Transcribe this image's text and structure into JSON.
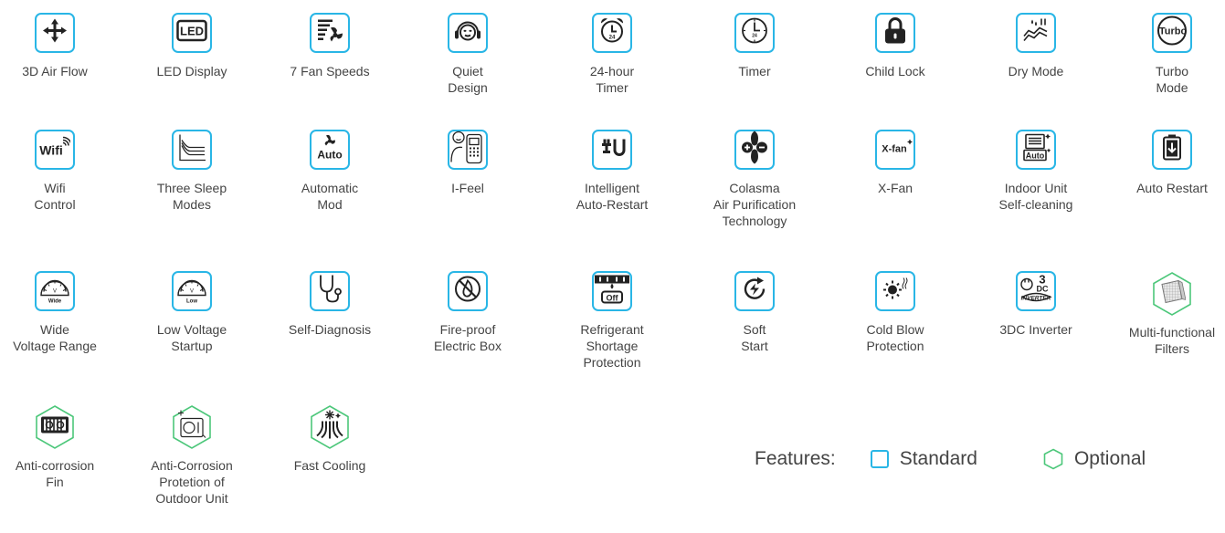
{
  "colors": {
    "standard": "#29b6e6",
    "optional": "#4cc77a",
    "icon": "#222222"
  },
  "features": [
    {
      "label": "3D Air Flow",
      "type": "standard",
      "icon": "arrows-icon"
    },
    {
      "label": "LED Display",
      "type": "standard",
      "icon": "led-icon"
    },
    {
      "label": "7 Fan Speeds",
      "type": "standard",
      "icon": "fan-speed-icon"
    },
    {
      "label": "Quiet\nDesign",
      "type": "standard",
      "icon": "headphones-icon"
    },
    {
      "label": "24-hour\nTimer",
      "type": "standard",
      "icon": "alarm-clock-icon"
    },
    {
      "label": "Timer",
      "type": "standard",
      "icon": "clock-icon"
    },
    {
      "label": "Child Lock",
      "type": "standard",
      "icon": "lock-icon"
    },
    {
      "label": "Dry Mode",
      "type": "standard",
      "icon": "dry-icon"
    },
    {
      "label": "Turbo\nMode",
      "type": "standard",
      "icon": "turbo-icon"
    },
    {
      "label": "Wifi\nControl",
      "type": "standard",
      "icon": "wifi-icon"
    },
    {
      "label": "Three Sleep\nModes",
      "type": "standard",
      "icon": "sleep-graph-icon"
    },
    {
      "label": "Automatic\nMod",
      "type": "standard",
      "icon": "auto-fan-icon"
    },
    {
      "label": "I-Feel",
      "type": "standard",
      "icon": "i-feel-icon"
    },
    {
      "label": "Intelligent\nAuto-Restart",
      "type": "standard",
      "icon": "plug-icon"
    },
    {
      "label": "Colasma\nAir Purification\nTechnology",
      "type": "standard",
      "icon": "plasma-icon"
    },
    {
      "label": "X-Fan",
      "type": "standard",
      "icon": "x-fan-icon"
    },
    {
      "label": "Indoor Unit\nSelf-cleaning",
      "type": "standard",
      "icon": "self-clean-icon"
    },
    {
      "label": "Auto Restart",
      "type": "standard",
      "icon": "battery-icon"
    },
    {
      "label": "Wide\nVoltage Range",
      "type": "standard",
      "icon": "gauge-wide-icon"
    },
    {
      "label": "Low Voltage\nStartup",
      "type": "standard",
      "icon": "gauge-low-icon"
    },
    {
      "label": "Self-Diagnosis",
      "type": "standard",
      "icon": "stethoscope-icon"
    },
    {
      "label": "Fire-proof\nElectric Box",
      "type": "standard",
      "icon": "fire-proof-icon"
    },
    {
      "label": "Refrigerant\nShortage\nProtection",
      "type": "standard",
      "icon": "refrigerant-icon"
    },
    {
      "label": "Soft\nStart",
      "type": "standard",
      "icon": "soft-start-icon"
    },
    {
      "label": "Cold Blow\nProtection",
      "type": "standard",
      "icon": "cold-blow-icon"
    },
    {
      "label": "3DC Inverter",
      "type": "standard",
      "icon": "inverter-icon"
    },
    {
      "label": "Multi-functional\nFilters",
      "type": "optional",
      "icon": "filter-icon"
    },
    {
      "label": "Anti-corrosion\nFin",
      "type": "optional",
      "icon": "fin-icon"
    },
    {
      "label": "Anti-Corrosion\nProtetion of\nOutdoor Unit",
      "type": "optional",
      "icon": "outdoor-unit-icon"
    },
    {
      "label": "Fast Cooling",
      "type": "optional",
      "icon": "fast-cooling-icon"
    }
  ],
  "icon_text": {
    "led": "LED",
    "auto": "Auto",
    "turbo": "Turbo",
    "wifi": "Wifi",
    "xfan": "X-fan",
    "wide": "Wide",
    "low": "Low",
    "off": "Off",
    "three": "3",
    "dc": "DC",
    "inverter": "INVERTER",
    "timer24": "24"
  },
  "legend": {
    "key": "Features:",
    "standard": "Standard",
    "optional": "Optional"
  }
}
